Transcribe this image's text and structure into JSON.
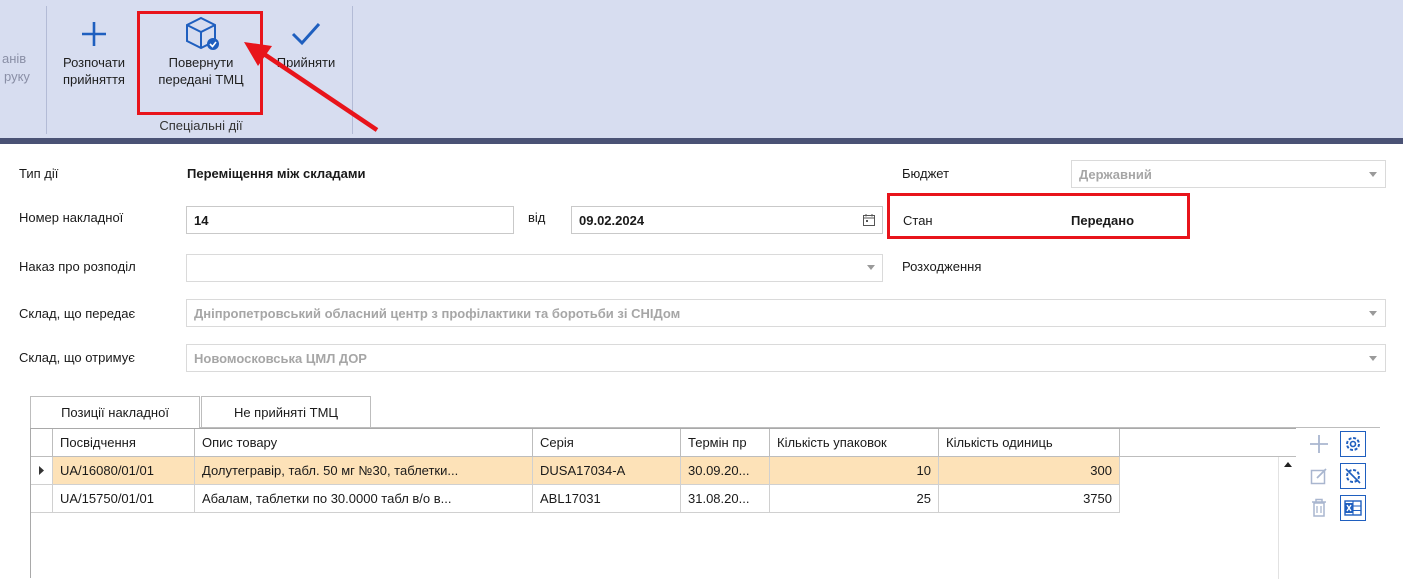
{
  "ribbon": {
    "partial_left_1": "анів",
    "partial_left_2": "руку",
    "buttons": [
      {
        "line1": "Розпочати",
        "line2": "прийняття",
        "icon": "plus-icon"
      },
      {
        "line1": "Повернути",
        "line2": "передані ТМЦ",
        "icon": "box-return-icon"
      },
      {
        "line1": "Прийняти",
        "line2": "",
        "icon": "checkmark-icon"
      }
    ],
    "group_label": "Спеціальні дії"
  },
  "form": {
    "action_type_label": "Тип дії",
    "action_type_value": "Переміщення між складами",
    "invoice_number_label": "Номер накладної",
    "invoice_number_value": "14",
    "date_from_label": "від",
    "date_value": "09.02.2024",
    "distribution_order_label": "Наказ про розподіл",
    "distribution_order_value": "",
    "sending_warehouse_label": "Склад, що передає",
    "sending_warehouse_value": "Дніпропетровський обласний центр з профілактики та боротьби зі СНІДом",
    "receiving_warehouse_label": "Склад, що отримує",
    "receiving_warehouse_value": "Новомосковська ЦМЛ ДОР",
    "budget_label": "Бюджет",
    "budget_value": "Державний",
    "status_label": "Стан",
    "status_value": "Передано",
    "discrepancy_label": "Розходження"
  },
  "tabs": [
    {
      "label": "Позиції накладної",
      "active": true
    },
    {
      "label": "Не прийняті ТМЦ",
      "active": false
    }
  ],
  "grid": {
    "columns": [
      "Посвідчення",
      "Опис товару",
      "Серія",
      "Термін пр",
      "Кількість упаковок",
      "Кількість одиниць"
    ],
    "rows": [
      {
        "cert": "UA/16080/01/01",
        "desc": "Долутегравір, табл. 50 мг №30, таблетки...",
        "series": "DUSA17034-A",
        "expiry": "30.09.20...",
        "packs": "10",
        "units": "300",
        "selected": true
      },
      {
        "cert": "UA/15750/01/01",
        "desc": "Абалам, таблетки  по 30.0000 табл в/о в...",
        "series": "ABL17031",
        "expiry": "31.08.20...",
        "packs": "25",
        "units": "3750",
        "selected": false
      }
    ]
  },
  "colors": {
    "ribbon_bg": "#d7ddf0",
    "accent_blue": "#1f5fbf",
    "highlight_red": "#e8141b",
    "selected_row": "#fde2b8"
  }
}
